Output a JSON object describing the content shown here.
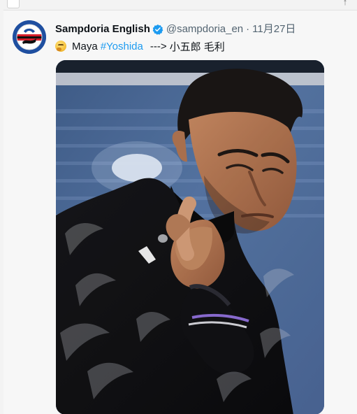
{
  "tweet": {
    "display_name": "Sampdoria English",
    "handle": "@sampdoria_en",
    "separator": "·",
    "date": "11月27日",
    "text": {
      "word": "Maya",
      "hashtag": "#Yoshida",
      "arrow": "--->",
      "name_jp": "小五郎 毛利"
    },
    "emoji_icon": "thinking-face-emoji",
    "verified_icon": "verified-badge-icon"
  },
  "colors": {
    "hashtag": "#1d9bf0",
    "verified": "#1d9bf0",
    "avatar_bg": "#1f4fa0"
  }
}
